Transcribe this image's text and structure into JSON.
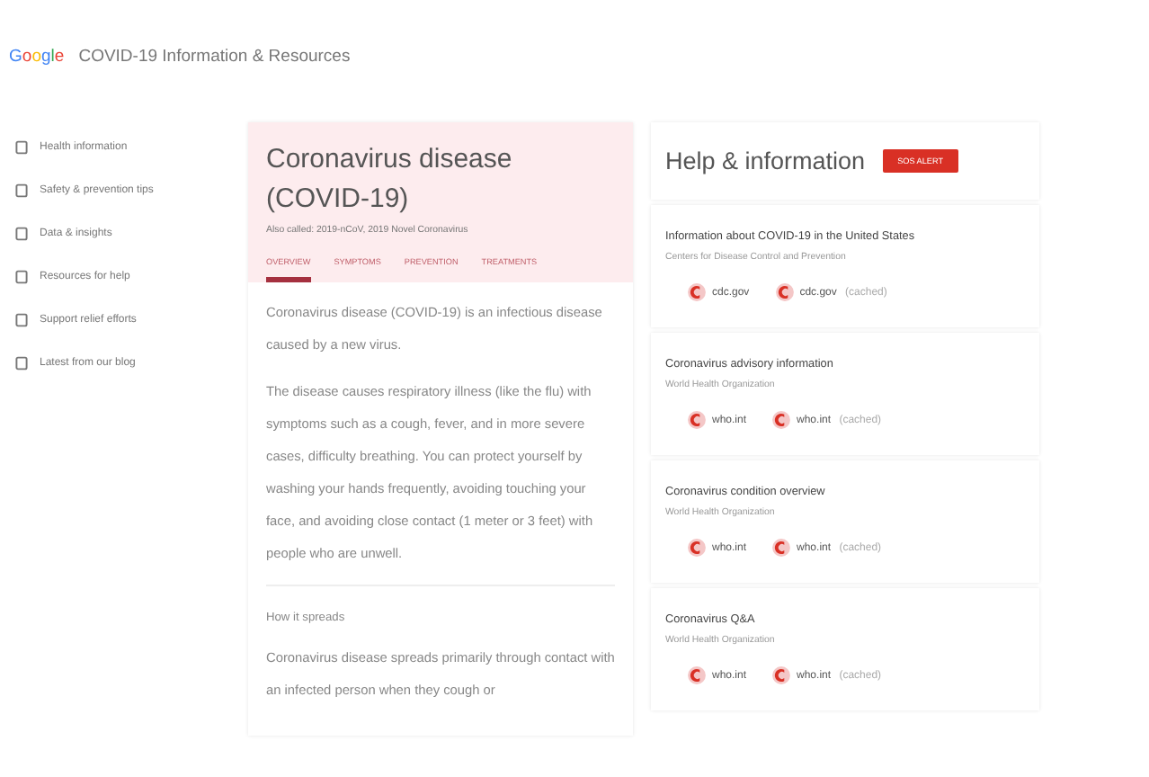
{
  "header": {
    "logo": "Google",
    "title": "COVID-19 Information & Resources"
  },
  "sidebar": {
    "items": [
      {
        "label": "Health information",
        "selected": false
      },
      {
        "label": "Safety & prevention tips",
        "selected": false
      },
      {
        "label": "Data & insights",
        "selected": false
      },
      {
        "label": "Resources for help",
        "selected": false
      },
      {
        "label": "Support relief efforts",
        "selected": false
      },
      {
        "label": "Latest from our blog",
        "selected": false
      }
    ]
  },
  "disease_card": {
    "title": "Coronavirus disease (COVID-19)",
    "subtitle": "Also called: 2019-nCoV, 2019 Novel Coronavirus",
    "tabs": [
      {
        "label": "OVERVIEW",
        "selected": true
      },
      {
        "label": "SYMPTOMS",
        "selected": false
      },
      {
        "label": "PREVENTION",
        "selected": false
      },
      {
        "label": "TREATMENTS",
        "selected": false
      }
    ],
    "paragraphs": [
      "Coronavirus disease (COVID-19) is an infectious disease caused by a new virus.",
      "The disease causes respiratory illness (like the flu) with symptoms such as a cough, fever, and in more severe cases, difficulty breathing. You can protect yourself by washing your hands frequently, avoiding touching your face, and avoiding close contact (1 meter or 3 feet) with people who are unwell."
    ],
    "section_title": "How it spreads",
    "section_text": "Coronavirus disease spreads primarily through contact with an infected person when they cough or"
  },
  "help_card": {
    "title": "Help & information",
    "badge": "SOS ALERT",
    "resources": [
      {
        "title": "Information about COVID-19 in the United States",
        "source": "Centers for Disease Control and Prevention",
        "links": [
          {
            "label": "cdc.gov"
          },
          {
            "label": "cdc.gov",
            "note": "(cached)"
          }
        ]
      },
      {
        "title": "Coronavirus advisory information",
        "source": "World Health Organization",
        "links": [
          {
            "label": "who.int"
          },
          {
            "label": "who.int",
            "note": "(cached)"
          }
        ]
      },
      {
        "title": "Coronavirus condition overview",
        "source": "World Health Organization",
        "links": [
          {
            "label": "who.int"
          },
          {
            "label": "who.int",
            "note": "(cached)"
          }
        ]
      },
      {
        "title": "Coronavirus Q&A",
        "source": "World Health Organization",
        "links": [
          {
            "label": "who.int"
          },
          {
            "label": "who.int",
            "note": "(cached)"
          }
        ]
      }
    ]
  }
}
